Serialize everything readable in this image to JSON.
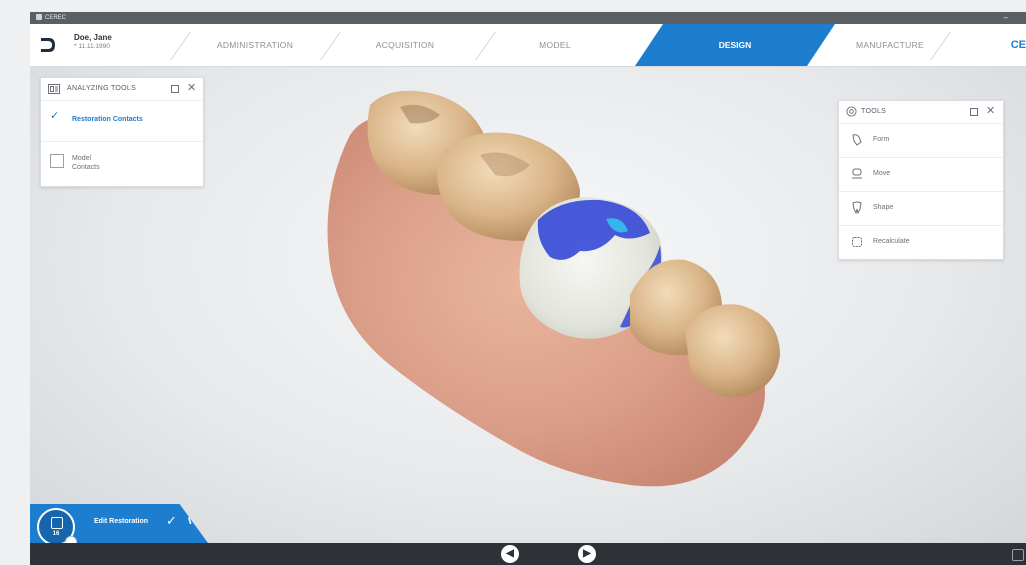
{
  "titlebar": {
    "app_name": "CEREC",
    "minimize": "–"
  },
  "patient": {
    "name": "Doe, Jane",
    "dob": "* 11.11.1990"
  },
  "workflow": {
    "steps": [
      "ADMINISTRATION",
      "ACQUISITION",
      "MODEL",
      "DESIGN",
      "MANUFACTURE"
    ],
    "active": "DESIGN",
    "brand": "CE"
  },
  "analyzing_tools": {
    "title": "ANALYZING TOOLS",
    "items": [
      {
        "label": "Restoration Contacts",
        "checked": true
      },
      {
        "label_line1": "Model",
        "label_line2": "Contacts",
        "checked": false
      }
    ]
  },
  "tools": {
    "title": "TOOLS",
    "items": [
      {
        "label": "Form",
        "icon": "form-icon"
      },
      {
        "label": "Move",
        "icon": "move-icon"
      },
      {
        "label": "Shape",
        "icon": "shape-icon"
      },
      {
        "label": "Recalculate",
        "icon": "recalculate-icon"
      }
    ]
  },
  "bottom": {
    "edit_label": "Edit Restoration",
    "tooth_number": "16",
    "prev": "◀",
    "next": "▶"
  },
  "colors": {
    "accent": "#1d7ed0",
    "bottom_bar": "#2e3236",
    "contact_blue": "#2a3fd6"
  }
}
